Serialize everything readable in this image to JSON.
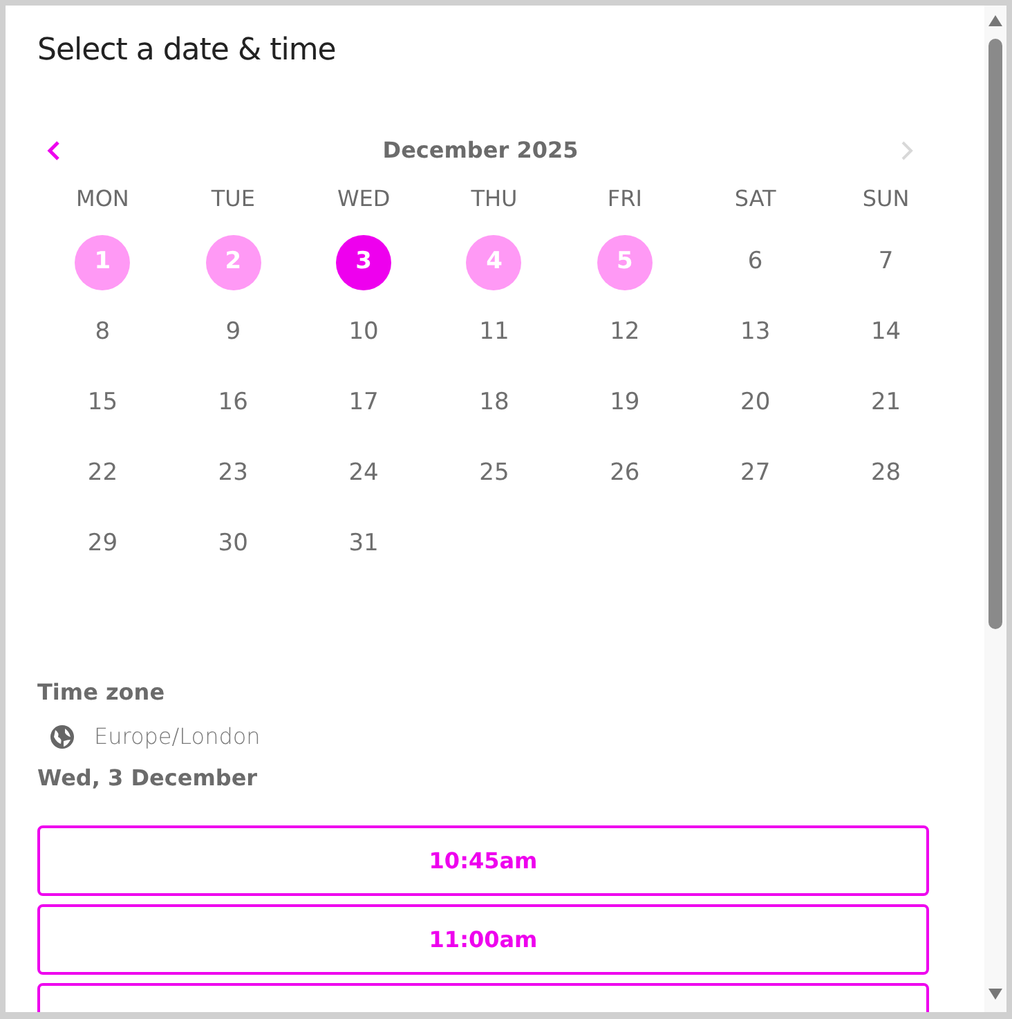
{
  "title": "Select a date & time",
  "calendar": {
    "prev_enabled": true,
    "next_enabled": false,
    "month": "December 2025",
    "weekdays": [
      "MON",
      "TUE",
      "WED",
      "THU",
      "FRI",
      "SAT",
      "SUN"
    ],
    "days": [
      {
        "label": "1",
        "available": true,
        "selected": false
      },
      {
        "label": "2",
        "available": true,
        "selected": false
      },
      {
        "label": "3",
        "available": true,
        "selected": true
      },
      {
        "label": "4",
        "available": true,
        "selected": false
      },
      {
        "label": "5",
        "available": true,
        "selected": false
      },
      {
        "label": "6",
        "available": false,
        "selected": false
      },
      {
        "label": "7",
        "available": false,
        "selected": false
      },
      {
        "label": "8",
        "available": false,
        "selected": false
      },
      {
        "label": "9",
        "available": false,
        "selected": false
      },
      {
        "label": "10",
        "available": false,
        "selected": false
      },
      {
        "label": "11",
        "available": false,
        "selected": false
      },
      {
        "label": "12",
        "available": false,
        "selected": false
      },
      {
        "label": "13",
        "available": false,
        "selected": false
      },
      {
        "label": "14",
        "available": false,
        "selected": false
      },
      {
        "label": "15",
        "available": false,
        "selected": false
      },
      {
        "label": "16",
        "available": false,
        "selected": false
      },
      {
        "label": "17",
        "available": false,
        "selected": false
      },
      {
        "label": "18",
        "available": false,
        "selected": false
      },
      {
        "label": "19",
        "available": false,
        "selected": false
      },
      {
        "label": "20",
        "available": false,
        "selected": false
      },
      {
        "label": "21",
        "available": false,
        "selected": false
      },
      {
        "label": "22",
        "available": false,
        "selected": false
      },
      {
        "label": "23",
        "available": false,
        "selected": false
      },
      {
        "label": "24",
        "available": false,
        "selected": false
      },
      {
        "label": "25",
        "available": false,
        "selected": false
      },
      {
        "label": "26",
        "available": false,
        "selected": false
      },
      {
        "label": "27",
        "available": false,
        "selected": false
      },
      {
        "label": "28",
        "available": false,
        "selected": false
      },
      {
        "label": "29",
        "available": false,
        "selected": false
      },
      {
        "label": "30",
        "available": false,
        "selected": false
      },
      {
        "label": "31",
        "available": false,
        "selected": false
      }
    ]
  },
  "time_zone": {
    "label": "Time zone",
    "value": "Europe/London"
  },
  "selected_date": "Wed, 3 December",
  "slots": [
    "10:45am",
    "11:00am"
  ]
}
